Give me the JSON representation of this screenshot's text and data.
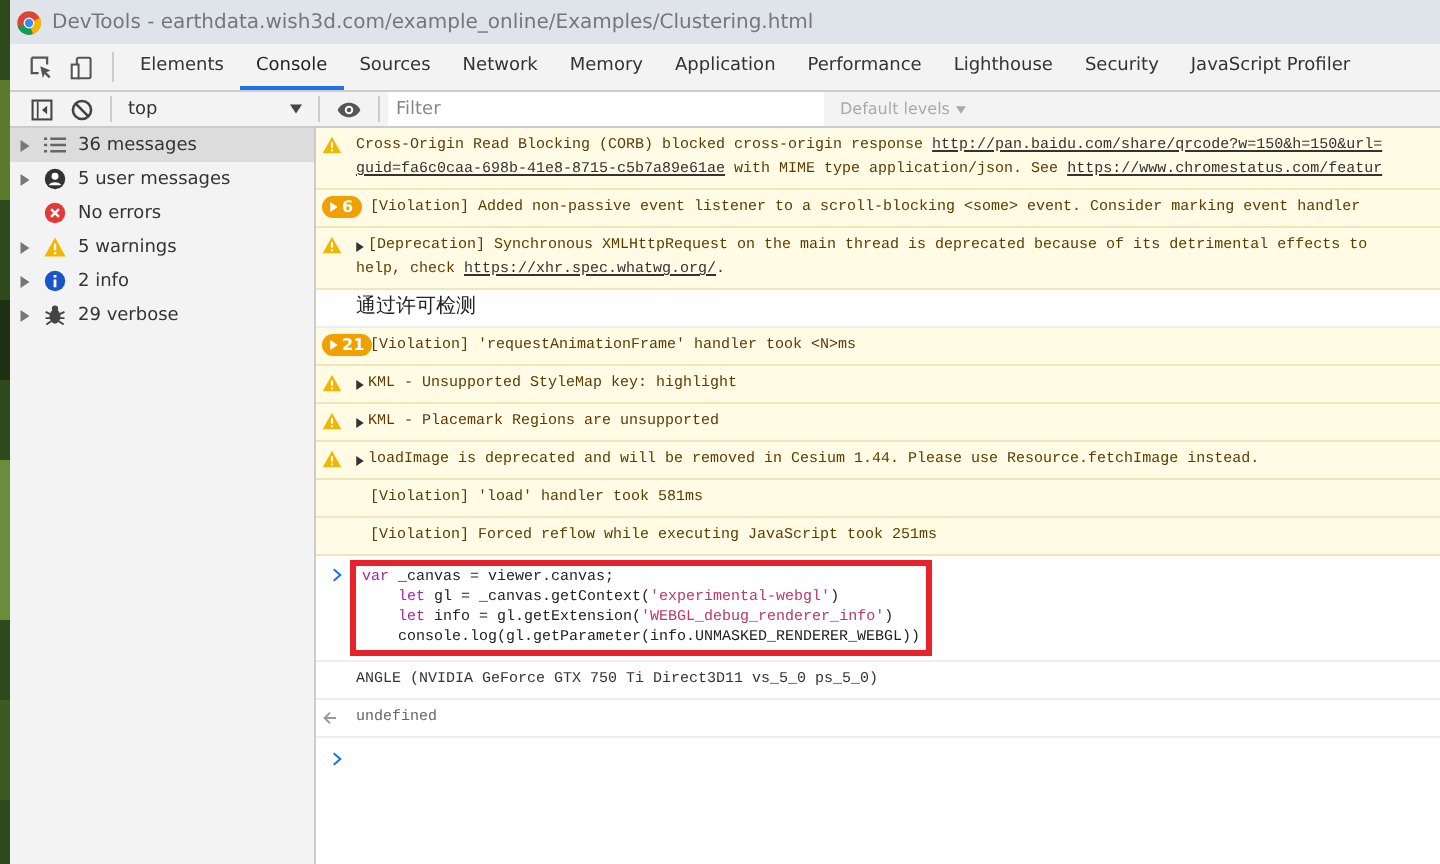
{
  "window": {
    "title": "DevTools - earthdata.wish3d.com/example_online/Examples/Clustering.html"
  },
  "tabs": [
    {
      "label": "Elements",
      "selected": false
    },
    {
      "label": "Console",
      "selected": true
    },
    {
      "label": "Sources",
      "selected": false
    },
    {
      "label": "Network",
      "selected": false
    },
    {
      "label": "Memory",
      "selected": false
    },
    {
      "label": "Application",
      "selected": false
    },
    {
      "label": "Performance",
      "selected": false
    },
    {
      "label": "Lighthouse",
      "selected": false
    },
    {
      "label": "Security",
      "selected": false
    },
    {
      "label": "JavaScript Profiler",
      "selected": false
    }
  ],
  "toolbar": {
    "context": "top",
    "filter": {
      "placeholder": "Filter"
    },
    "levels": "Default levels"
  },
  "sidebar": {
    "items": [
      {
        "label": "36 messages",
        "kind": "list",
        "selected": true,
        "expandable": true
      },
      {
        "label": "5 user messages",
        "kind": "user",
        "selected": false,
        "expandable": true
      },
      {
        "label": "No errors",
        "kind": "error",
        "selected": false,
        "expandable": false
      },
      {
        "label": "5 warnings",
        "kind": "warning",
        "selected": false,
        "expandable": true
      },
      {
        "label": "2 info",
        "kind": "info",
        "selected": false,
        "expandable": true
      },
      {
        "label": "29 verbose",
        "kind": "verbose",
        "selected": false,
        "expandable": true
      }
    ]
  },
  "console": {
    "messages": [
      {
        "kind": "warning",
        "expandable": false,
        "lines": [
          [
            {
              "text": "Cross-Origin Read Blocking (CORB) blocked cross-origin response ",
              "link": false
            },
            {
              "text": "http://pan.baidu.com/share/qrcode?w=150&h=150&url=",
              "link": true
            }
          ],
          [
            {
              "text": "guid=fa6c0caa-698b-41e8-8715-c5b7a89e61ae",
              "link": true
            },
            {
              "text": " with MIME type application/json. See ",
              "link": false
            },
            {
              "text": "https://www.chromestatus.com/featur",
              "link": true
            }
          ]
        ]
      },
      {
        "kind": "verbose",
        "count": "6",
        "expandable": false,
        "lines": [
          [
            {
              "text": "[Violation] Added non-passive event listener to a scroll-blocking <some> event. Consider marking event handler",
              "link": false
            }
          ]
        ]
      },
      {
        "kind": "warning",
        "expandable": true,
        "lines": [
          [
            {
              "text": "[Deprecation] Synchronous XMLHttpRequest on the main thread is deprecated because of its detrimental effects to",
              "link": false
            }
          ],
          [
            {
              "text": "help, check ",
              "link": false
            },
            {
              "text": "https://xhr.spec.whatwg.org/",
              "link": true
            },
            {
              "text": ".",
              "link": false
            }
          ]
        ]
      },
      {
        "kind": "log",
        "expandable": false,
        "lines": [
          [
            {
              "text": "通过许可检测",
              "link": false
            }
          ]
        ]
      },
      {
        "kind": "verbose",
        "count": "21",
        "expandable": false,
        "lines": [
          [
            {
              "text": "[Violation] 'requestAnimationFrame' handler took <N>ms",
              "link": false
            }
          ]
        ]
      },
      {
        "kind": "warning",
        "expandable": true,
        "lines": [
          [
            {
              "text": "KML - Unsupported StyleMap key: highlight",
              "link": false
            }
          ]
        ]
      },
      {
        "kind": "warning",
        "expandable": true,
        "lines": [
          [
            {
              "text": "KML - Placemark Regions are unsupported",
              "link": false
            }
          ]
        ]
      },
      {
        "kind": "warning",
        "expandable": true,
        "lines": [
          [
            {
              "text": "loadImage is deprecated and will be removed in Cesium 1.44. Please use Resource.fetchImage instead.",
              "link": false
            }
          ]
        ]
      },
      {
        "kind": "verbose",
        "expandable": false,
        "lines": [
          [
            {
              "text": "[Violation] 'load' handler took 581ms",
              "link": false
            }
          ]
        ]
      },
      {
        "kind": "verbose",
        "expandable": false,
        "lines": [
          [
            {
              "text": "[Violation] Forced reflow while executing JavaScript took 251ms",
              "link": false
            }
          ]
        ]
      }
    ],
    "input": {
      "highlighted": true,
      "lines": [
        [
          {
            "text": "var",
            "kind": "keyword"
          },
          {
            "text": " _canvas = viewer.canvas;",
            "kind": "plain"
          }
        ],
        [
          {
            "text": "    let",
            "kind": "keyword"
          },
          {
            "text": " gl = _canvas.getContext(",
            "kind": "plain"
          },
          {
            "text": "'experimental-webgl'",
            "kind": "string"
          },
          {
            "text": ")",
            "kind": "plain"
          }
        ],
        [
          {
            "text": "    let",
            "kind": "keyword"
          },
          {
            "text": " info = gl.getExtension(",
            "kind": "plain"
          },
          {
            "text": "'WEBGL_debug_renderer_info'",
            "kind": "string"
          },
          {
            "text": ")",
            "kind": "plain"
          }
        ],
        [
          {
            "text": "    console.log(gl.getParameter(info.UNMASKED_RENDERER_WEBGL))",
            "kind": "plain"
          }
        ]
      ]
    },
    "output": "ANGLE (NVIDIA GeForce GTX 750 Ti Direct3D11 vs_5_0 ps_5_0)",
    "result": "undefined"
  }
}
